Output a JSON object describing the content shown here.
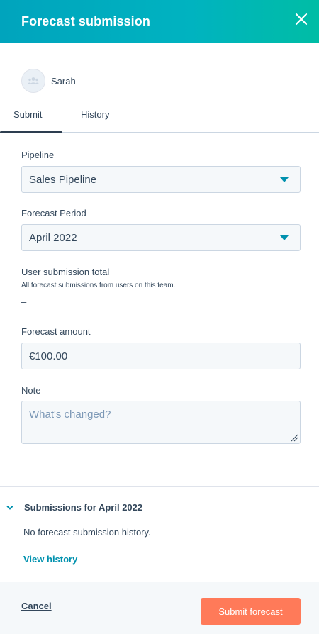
{
  "header": {
    "title": "Forecast submission",
    "close_icon": "close-icon"
  },
  "user": {
    "name": "Sarah",
    "avatar_icon": "team-icon"
  },
  "tabs": [
    {
      "label": "Submit",
      "active": true
    },
    {
      "label": "History",
      "active": false
    }
  ],
  "form": {
    "pipeline": {
      "label": "Pipeline",
      "value": "Sales Pipeline"
    },
    "forecast_period": {
      "label": "Forecast Period",
      "value": "April 2022"
    },
    "user_submission_total": {
      "label": "User submission total",
      "description": "All forecast submissions from users on this team.",
      "value": "–"
    },
    "forecast_amount": {
      "label": "Forecast amount",
      "value": "€100.00"
    },
    "note": {
      "label": "Note",
      "placeholder": "What's changed?",
      "value": ""
    }
  },
  "submissions": {
    "title": "Submissions for April 2022",
    "empty_text": "No forecast submission history.",
    "view_history_label": "View history",
    "expanded": true
  },
  "footer": {
    "cancel_label": "Cancel",
    "submit_label": "Submit forecast"
  },
  "colors": {
    "header_gradient_start": "#00a4bd",
    "header_gradient_end": "#00bda5",
    "primary_button": "#ff7a59",
    "link": "#0091ae",
    "text": "#33475b"
  }
}
